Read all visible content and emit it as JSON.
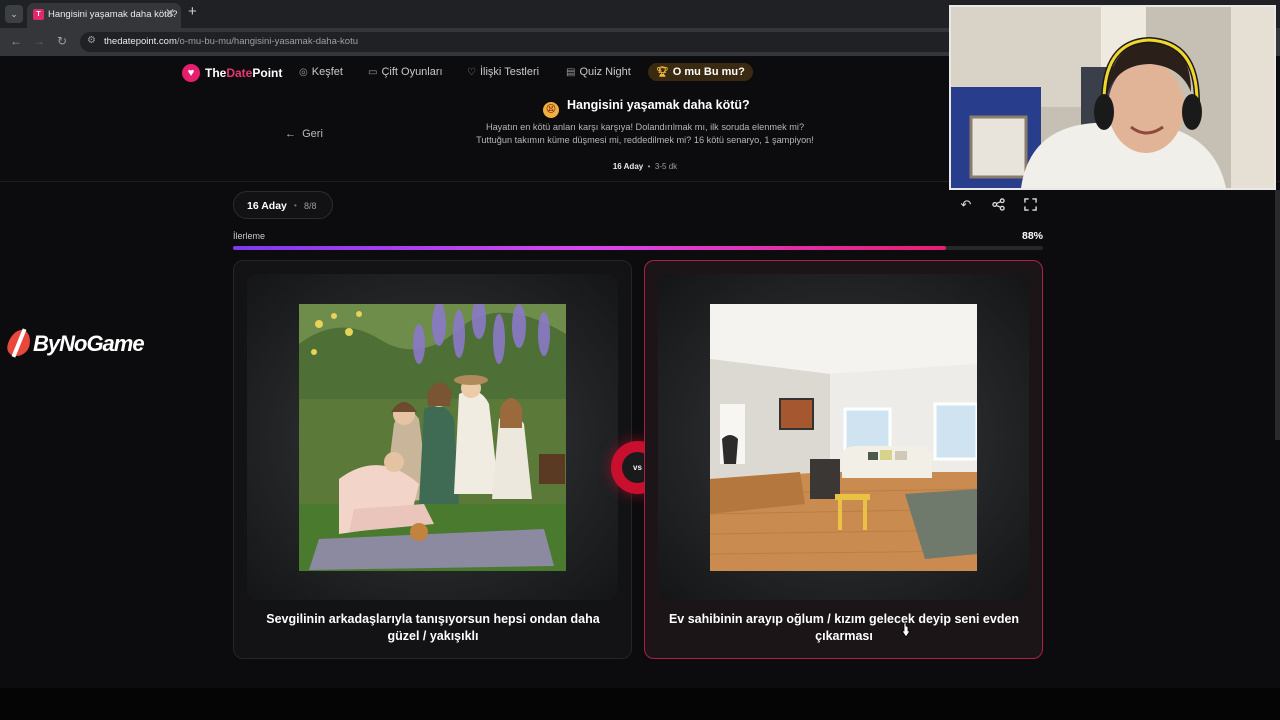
{
  "browser": {
    "tab_title": "Hangisini yaşamak daha kötü?",
    "tab_favicon": "T",
    "url_domain": "thedatepoint.com",
    "url_path": "/o-mu-bu-mu/hangisini-yasamak-daha-kotu"
  },
  "site": {
    "logo_prefix": "The",
    "logo_accent": "Date",
    "logo_suffix": "Point",
    "brand_color": "#e61e6e",
    "nav": [
      {
        "label": "Keşfet",
        "icon": "compass-icon"
      },
      {
        "label": "Çift Oyunları",
        "icon": "gamepad-icon"
      },
      {
        "label": "İlişki Testleri",
        "icon": "heart-outline-icon"
      },
      {
        "label": "Quiz Night",
        "icon": "quiz-icon"
      },
      {
        "label": "O mu Bu mu?",
        "icon": "trophy-icon",
        "active": true
      }
    ]
  },
  "hero": {
    "back_label": "Geri",
    "title": "Hangisini yaşamak daha kötü?",
    "description": "Hayatın en kötü anları karşı karşıya! Dolandırılmak mı, ilk soruda elenmek mi? Tuttuğun takımın küme düşmesi mi, reddedilmek mi? 16 kötü senaryo, 1 şampiyon!",
    "meta_count": "16 Aday",
    "meta_time": "3-5 dk"
  },
  "game": {
    "candidates_label": "16 Aday",
    "round_label": "8/8",
    "progress_label": "İlerleme",
    "progress_percent": "88%",
    "progress_value": 0.88,
    "vs_label": "vs",
    "options": [
      {
        "caption": "Sevgilinin arkadaşlarıyla tanışıyorsun hepsi ondan daha güzel / yakışıklı",
        "selected": false
      },
      {
        "caption": "Ev sahibinin arayıp oğlum / kızım gelecek deyip seni evden çıkarması",
        "selected": true
      }
    ]
  },
  "overlay": {
    "brand_text": "ByNoGame"
  }
}
